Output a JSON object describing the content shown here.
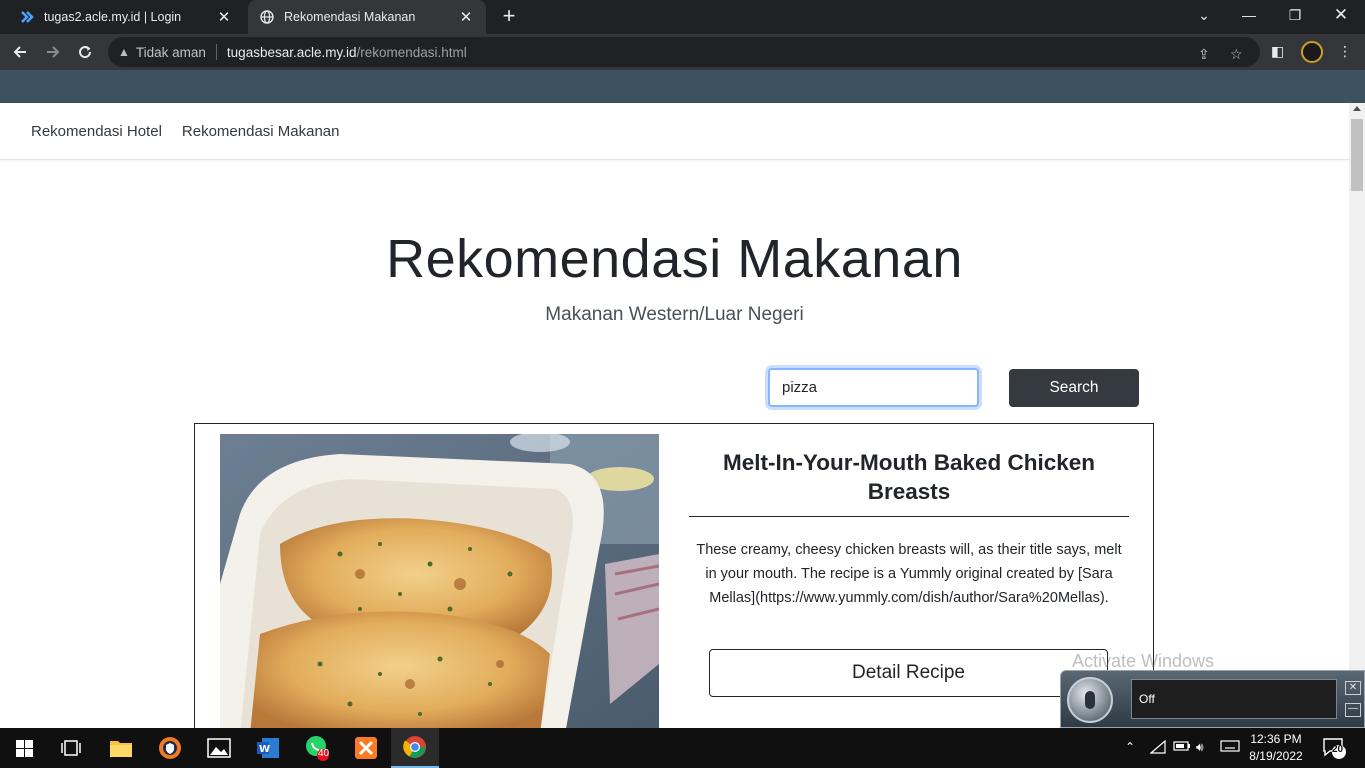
{
  "browser": {
    "tabs": [
      {
        "title": "tugas2.acle.my.id | Login",
        "active": false
      },
      {
        "title": "Rekomendasi Makanan",
        "active": true
      }
    ],
    "security_label": "Tidak aman",
    "url_domain": "tugasbesar.acle.my.id",
    "url_path": "/rekomendasi.html"
  },
  "site_nav": {
    "items": [
      {
        "label": "Rekomendasi Hotel"
      },
      {
        "label": "Rekomendasi Makanan"
      }
    ]
  },
  "hero": {
    "title": "Rekomendasi Makanan",
    "subtitle": "Makanan Western/Luar Negeri"
  },
  "search": {
    "value": "pizza",
    "button_label": "Search"
  },
  "recipe": {
    "title": "Melt-In-Your-Mouth Baked Chicken Breasts",
    "description": "These creamy, cheesy chicken breasts will, as their title says, melt in your mouth. The recipe is a Yummly original created by [Sara Mellas](https://www.yummly.com/dish/author/Sara%20Mellas).",
    "button_label": "Detail Recipe"
  },
  "watermark": "Activate Windows",
  "speech": {
    "status": "Off"
  },
  "taskbar": {
    "whatsapp_badge": "40",
    "time": "12:36 PM",
    "date": "8/19/2022",
    "notification_count": "20"
  }
}
